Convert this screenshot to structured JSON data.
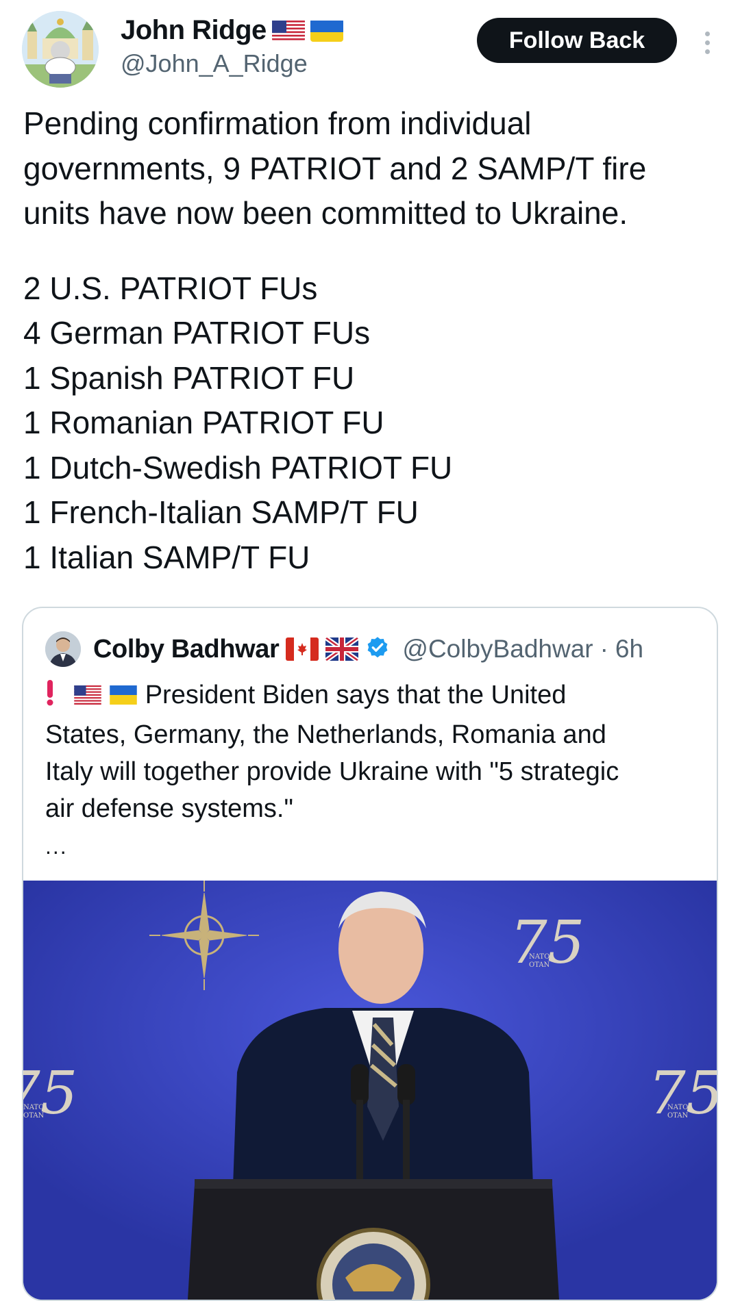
{
  "author": {
    "display_name": "John Ridge",
    "handle": "@John_A_Ridge",
    "flags": [
      "us-flag-icon",
      "ukraine-flag-icon"
    ]
  },
  "actions": {
    "follow_label": "Follow Back",
    "more_icon": "more-vertical-icon"
  },
  "tweet": {
    "lines": [
      "Pending confirmation from individual",
      "governments, 9 PATRIOT and 2 SAMP/T fire",
      "units have now been committed to Ukraine.",
      "",
      "2 U.S. PATRIOT FUs",
      "4 German PATRIOT FUs",
      "1 Spanish PATRIOT FU",
      "1 Romanian PATRIOT FU",
      "1 Dutch-Swedish PATRIOT FU",
      "1 French-Italian SAMP/T FU",
      "1 Italian SAMP/T FU"
    ]
  },
  "quote": {
    "display_name": "Colby Badhwar",
    "handle": "@ColbyBadhwar",
    "separator": "·",
    "time": "6h",
    "flags": [
      "canada-flag-icon",
      "uk-flag-icon"
    ],
    "verified_icon": "verified-badge-icon",
    "lines": [
      "President Biden says that the United",
      "States, Germany, the Netherlands, Romania and",
      "Italy will together provide Ukraine with \"5 strategic",
      "air defense systems.\""
    ],
    "prefix_icons": [
      "exclamation-icon",
      "us-flag-icon",
      "ukraine-flag-icon"
    ],
    "more": "...",
    "image_texts": [
      "75",
      "NATO",
      "OTAN"
    ]
  },
  "colors": {
    "text": "#0f1419",
    "secondary": "#536471",
    "button_bg": "#0f1419",
    "verified": "#1d9bf0",
    "stage_blue": "#3a45c4"
  }
}
